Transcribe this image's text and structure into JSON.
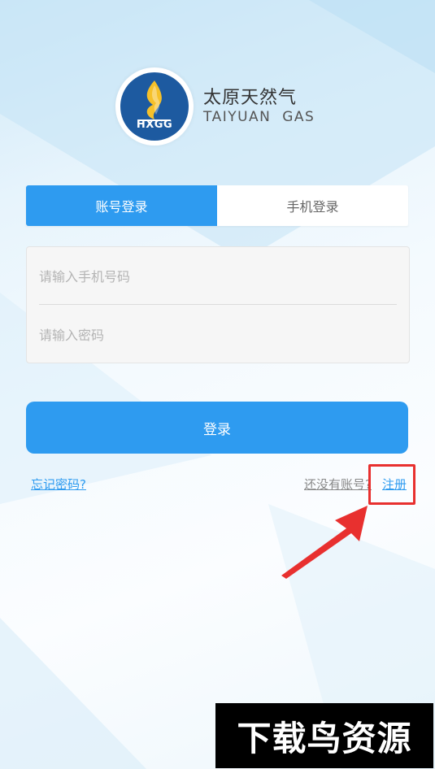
{
  "brand": {
    "logo_abbr": "HXGG",
    "name_cn": "太原天然气",
    "name_en": "TAIYUAN  GAS"
  },
  "tabs": [
    {
      "label": "账号登录",
      "active": true
    },
    {
      "label": "手机登录",
      "active": false
    }
  ],
  "form": {
    "phone_placeholder": "请输入手机号码",
    "password_placeholder": "请输入密码"
  },
  "login_button": "登录",
  "links": {
    "forgot": "忘记密码?",
    "no_account": "还没有账号?",
    "register": "注册"
  },
  "watermark": "下载鸟资源",
  "colors": {
    "accent": "#2e9bf0",
    "annotation": "#e8302f"
  }
}
